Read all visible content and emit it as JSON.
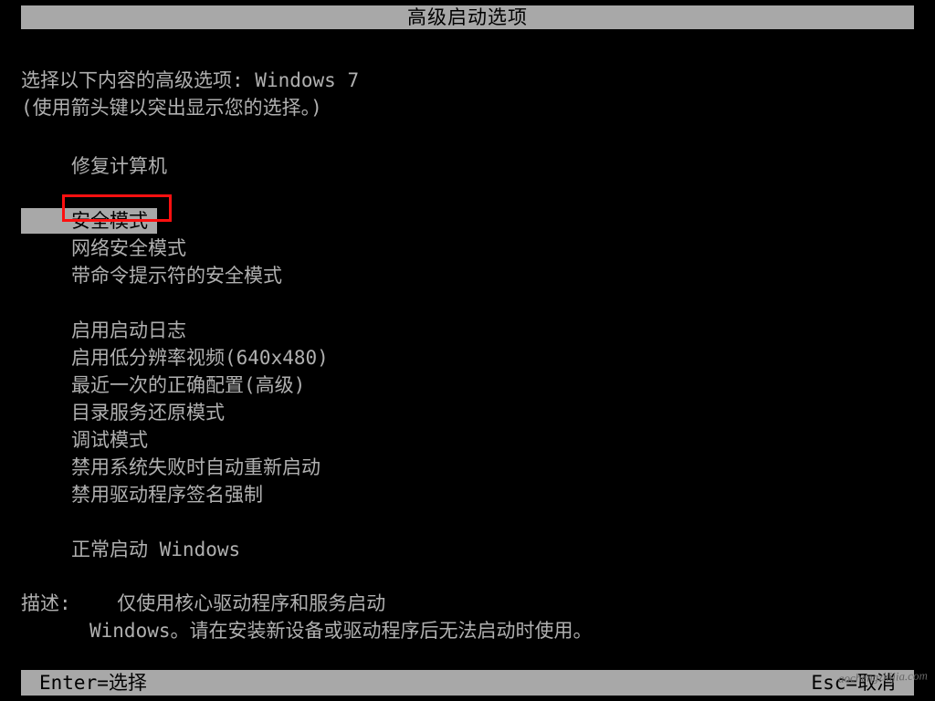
{
  "title": "高级启动选项",
  "instruction_line1_prefix": "选择以下内容的高级选项: ",
  "instruction_line1_os": "Windows 7",
  "instruction_line2": "(使用箭头键以突出显示您的选择。)",
  "options": {
    "repair": "修复计算机",
    "safe_mode": "安全模式",
    "safe_mode_net": "网络安全模式",
    "safe_mode_cmd": "带命令提示符的安全模式",
    "boot_log": "启用启动日志",
    "low_res": "启用低分辨率视频(640x480)",
    "last_known": "最近一次的正确配置(高级)",
    "ds_restore": "目录服务还原模式",
    "debug": "调试模式",
    "disable_auto_restart": "禁用系统失败时自动重新启动",
    "disable_driver_sig": "禁用驱动程序签名强制",
    "normal_start": "正常启动 Windows"
  },
  "description_label": "描述:",
  "description_line1": "仅使用核心驱动程序和服务启动",
  "description_line2": "Windows。请在安装新设备或驱动程序后无法启动时使用。",
  "footer": {
    "enter": "Enter=选择",
    "esc": "Esc=取消"
  },
  "watermark": "aochengzhijia.com"
}
